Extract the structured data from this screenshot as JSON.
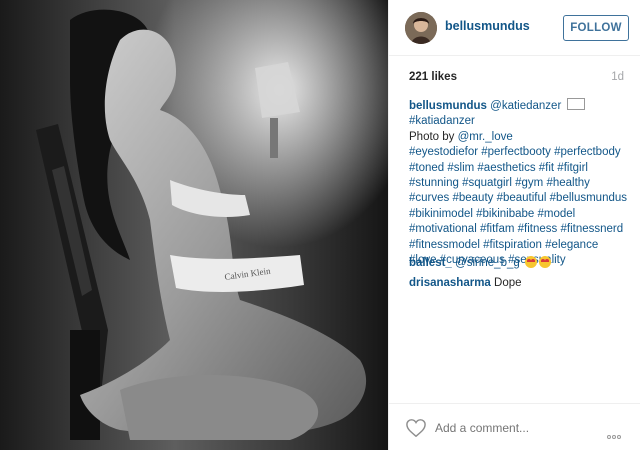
{
  "post": {
    "username": "bellusmundus",
    "follow_label": "FOLLOW",
    "likes": "221 likes",
    "age": "1d"
  },
  "caption": {
    "author": "bellusmundus",
    "lines": [
      "@katiedanzer",
      "#katiadanzer",
      "Photo by @mr._love",
      "#eyestodiefor #perfectbooty #perfectbody",
      "#toned #slim #aesthetics #fit #fitgirl",
      "#stunning #squatgirl #gym #healthy",
      "#curves #beauty #beautiful #bellusmundus",
      "#bikinimodel #bikinibabe #model",
      "#motivational #fitfam #fitness #fitnessnerd",
      "#fitnessmodel #fitspiration #elegance",
      "#love #curvaceous #sensuality"
    ],
    "photo_credit_prefix": "Photo by "
  },
  "comments": [
    {
      "user": "ballest_",
      "text": "@sirine_b_g"
    },
    {
      "user": "drisanasharma",
      "text": "Dope"
    }
  ],
  "footer": {
    "add_comment_placeholder": "Add a comment..."
  },
  "icons": {
    "like": "heart-icon",
    "more": "more-options-icon"
  },
  "colors": {
    "link": "#125688",
    "follow": "#3f729b"
  }
}
